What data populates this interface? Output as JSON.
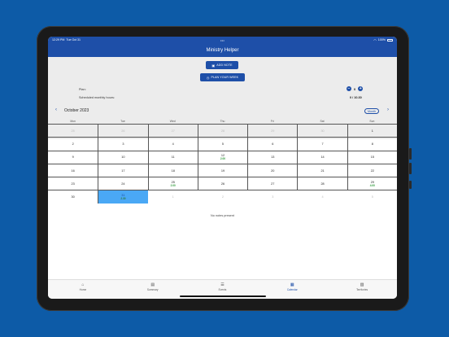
{
  "status": {
    "time": "12:29 PM",
    "date": "Tue Oct 31",
    "dots": "•••",
    "battery": "100%"
  },
  "nav": {
    "title": "Ministry Helper"
  },
  "actions": {
    "add_note": "ADD NOTE",
    "plan_week": "PLAN YOUR WEEK"
  },
  "plan": {
    "label": "Plan:",
    "value": "0",
    "minus": "−",
    "plus": "+"
  },
  "hours": {
    "label": "Scheduled monthly hours:",
    "value": "0 / 10.30"
  },
  "calendar": {
    "month_title": "October 2023",
    "view_toggle": "Month",
    "prev": "‹",
    "next": "›",
    "weekdays": [
      "Mon",
      "Tue",
      "Wed",
      "Thu",
      "Fri",
      "Sat",
      "Sun"
    ],
    "weeks": [
      [
        {
          "d": "25",
          "o": true
        },
        {
          "d": "26",
          "o": true
        },
        {
          "d": "27",
          "o": true
        },
        {
          "d": "28",
          "o": true
        },
        {
          "d": "29",
          "o": true
        },
        {
          "d": "30",
          "o": true
        },
        {
          "d": "1"
        }
      ],
      [
        {
          "d": "2"
        },
        {
          "d": "3"
        },
        {
          "d": "4"
        },
        {
          "d": "5"
        },
        {
          "d": "6"
        },
        {
          "d": "7"
        },
        {
          "d": "8"
        }
      ],
      [
        {
          "d": "9"
        },
        {
          "d": "10"
        },
        {
          "d": "11"
        },
        {
          "d": "12",
          "h": "2.00"
        },
        {
          "d": "13"
        },
        {
          "d": "14"
        },
        {
          "d": "15"
        }
      ],
      [
        {
          "d": "16"
        },
        {
          "d": "17"
        },
        {
          "d": "18"
        },
        {
          "d": "19"
        },
        {
          "d": "20"
        },
        {
          "d": "21"
        },
        {
          "d": "22"
        }
      ],
      [
        {
          "d": "23"
        },
        {
          "d": "24"
        },
        {
          "d": "25",
          "h": "2.00"
        },
        {
          "d": "26"
        },
        {
          "d": "27"
        },
        {
          "d": "28"
        },
        {
          "d": "29",
          "h": "4.00"
        }
      ],
      [
        {
          "d": "30"
        },
        {
          "d": "31",
          "h": "2.30",
          "sel": true
        },
        {
          "d": "1",
          "o": true
        },
        {
          "d": "2",
          "o": true
        },
        {
          "d": "3",
          "o": true
        },
        {
          "d": "4",
          "o": true
        },
        {
          "d": "5",
          "o": true
        }
      ]
    ]
  },
  "notes": {
    "empty": "No notes present"
  },
  "tabs": [
    {
      "label": "Home",
      "icon": "home-icon",
      "glyph": "⌂"
    },
    {
      "label": "Summary",
      "icon": "summary-icon",
      "glyph": "▤"
    },
    {
      "label": "Events",
      "icon": "events-icon",
      "glyph": "☰"
    },
    {
      "label": "Calendar",
      "icon": "calendar-icon",
      "glyph": "▦",
      "active": true
    },
    {
      "label": "Territories",
      "icon": "territories-icon",
      "glyph": "▧"
    }
  ],
  "colors": {
    "primary": "#1e4fa8",
    "selected": "#4aa8f5",
    "hours": "#2e9a3a",
    "background": "#0d5ba7"
  }
}
